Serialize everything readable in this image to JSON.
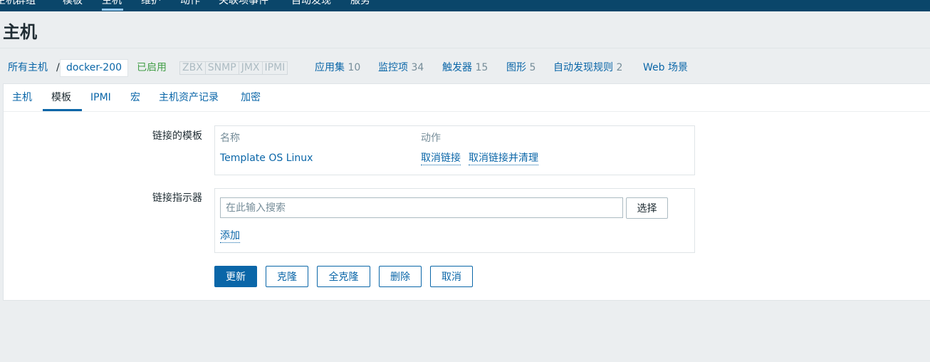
{
  "topnav": {
    "items": [
      "主机群组",
      "模板",
      "主机",
      "维护",
      "动作",
      "关联项事件",
      "自动发现",
      "服务"
    ],
    "active_index": 2
  },
  "page_title": "主机",
  "host_nav": {
    "all_hosts": "所有主机",
    "separator": "/",
    "current_host": "docker-200",
    "status": "已启用",
    "availability": [
      "ZBX",
      "SNMP",
      "JMX",
      "IPMI"
    ],
    "links": [
      {
        "label": "应用集",
        "count": "10"
      },
      {
        "label": "监控项",
        "count": "34"
      },
      {
        "label": "触发器",
        "count": "15"
      },
      {
        "label": "图形",
        "count": "5"
      },
      {
        "label": "自动发现规则",
        "count": "2"
      },
      {
        "label": "Web 场景",
        "count": ""
      }
    ]
  },
  "tabs": [
    "主机",
    "模板",
    "IPMI",
    "宏",
    "主机资产记录",
    "加密"
  ],
  "active_tab_index": 1,
  "linked_templates": {
    "label": "链接的模板",
    "col_name": "名称",
    "col_action": "动作",
    "rows": [
      {
        "name": "Template OS Linux",
        "unlink": "取消链接",
        "unlink_clear": "取消链接并清理"
      }
    ]
  },
  "link_indicator": {
    "label": "链接指示器",
    "placeholder": "在此输入搜索",
    "select_label": "选择",
    "add_label": "添加"
  },
  "buttons": {
    "update": "更新",
    "clone": "克隆",
    "full_clone": "全克隆",
    "delete": "删除",
    "cancel": "取消"
  },
  "colors": {
    "nav_bg": "#0a466a",
    "link": "#0a66a8",
    "enabled": "#429e47",
    "page_bg": "#ebeef0"
  }
}
